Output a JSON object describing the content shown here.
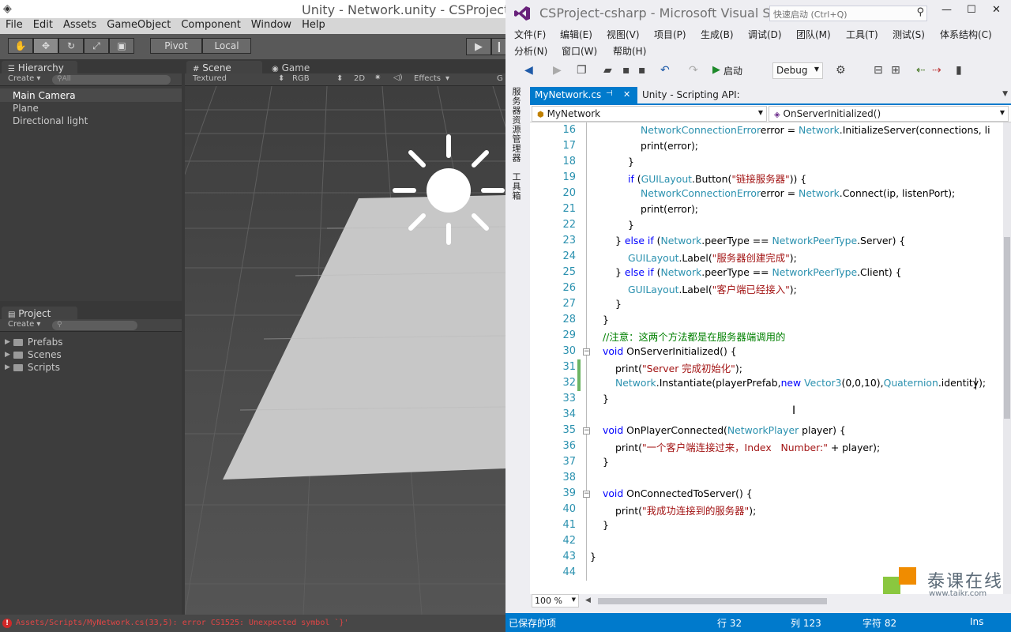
{
  "unity": {
    "title": "Unity - Network.unity - CSProject - P",
    "menu": [
      "File",
      "Edit",
      "Assets",
      "GameObject",
      "Component",
      "Window",
      "Help"
    ],
    "toolbar": {
      "pivot": "Pivot",
      "local": "Local"
    },
    "hierarchy": {
      "tab": "Hierarchy",
      "create": "Create ▾",
      "search": "All",
      "items": [
        "Main Camera",
        "Plane",
        "Directional light"
      ]
    },
    "scene": {
      "tab_scene": "Scene",
      "tab_game": "Game",
      "shading": "Textured",
      "render": "RGB",
      "mode_2d": "2D",
      "effects": "Effects",
      "gizmos": "G"
    },
    "project": {
      "tab": "Project",
      "create": "Create ▾",
      "folders": [
        "Prefabs",
        "Scenes",
        "Scripts"
      ]
    },
    "status_error": "Assets/Scripts/MyNetwork.cs(33,5): error CS1525: Unexpected symbol `}'"
  },
  "vs": {
    "title": "CSProject-csharp - Microsoft Visual St...",
    "quick_launch": "快速启动 (Ctrl+Q)",
    "menu_row1": [
      "文件(F)",
      "编辑(E)",
      "视图(V)",
      "项目(P)",
      "生成(B)",
      "调试(D)",
      "团队(M)",
      "工具(T)",
      "测试(S)",
      "体系结构(C)"
    ],
    "menu_row2": [
      "分析(N)",
      "窗口(W)",
      "帮助(H)"
    ],
    "start": "启动",
    "config": "Debug",
    "side_tabs": [
      "服务器资源管理器",
      "工具箱"
    ],
    "tabs": {
      "active": "MyNetwork.cs",
      "pin": "⊣",
      "close": "✕",
      "other": "Unity - Scripting API:"
    },
    "nav": {
      "class": "MyNetwork",
      "member": "OnServerInitialized()"
    },
    "code": [
      {
        "n": "16",
        "i": 4,
        "parts": [
          [
            "t",
            "NetworkConnectionError"
          ],
          [
            "",
            "error = "
          ],
          [
            "t",
            "Network"
          ],
          [
            "",
            ".InitializeServer(connections, li"
          ]
        ]
      },
      {
        "n": "17",
        "i": 4,
        "parts": [
          [
            "",
            "print(error);"
          ]
        ]
      },
      {
        "n": "18",
        "i": 3,
        "parts": [
          [
            "",
            "}"
          ]
        ]
      },
      {
        "n": "19",
        "i": 3,
        "parts": [
          [
            "k",
            "if"
          ],
          [
            "",
            " ("
          ],
          [
            "t",
            "GUILayout"
          ],
          [
            "",
            ".Button("
          ],
          [
            "s",
            "\"链接服务器\""
          ],
          [
            "",
            ")) {"
          ]
        ]
      },
      {
        "n": "20",
        "i": 4,
        "parts": [
          [
            "t",
            "NetworkConnectionError"
          ],
          [
            "",
            "error = "
          ],
          [
            "t",
            "Network"
          ],
          [
            "",
            ".Connect(ip, listenPort);"
          ]
        ]
      },
      {
        "n": "21",
        "i": 4,
        "parts": [
          [
            "",
            "print(error);"
          ]
        ]
      },
      {
        "n": "22",
        "i": 3,
        "parts": [
          [
            "",
            "}"
          ]
        ]
      },
      {
        "n": "23",
        "i": 2,
        "parts": [
          [
            "",
            "} "
          ],
          [
            "k",
            "else if"
          ],
          [
            "",
            " ("
          ],
          [
            "t",
            "Network"
          ],
          [
            "",
            ".peerType == "
          ],
          [
            "t",
            "NetworkPeerType"
          ],
          [
            "",
            ".Server) {"
          ]
        ]
      },
      {
        "n": "24",
        "i": 3,
        "parts": [
          [
            "t",
            "GUILayout"
          ],
          [
            "",
            ".Label("
          ],
          [
            "s",
            "\"服务器创建完成\""
          ],
          [
            "",
            ");"
          ]
        ]
      },
      {
        "n": "25",
        "i": 2,
        "parts": [
          [
            "",
            "} "
          ],
          [
            "k",
            "else if"
          ],
          [
            "",
            " ("
          ],
          [
            "t",
            "Network"
          ],
          [
            "",
            ".peerType == "
          ],
          [
            "t",
            "NetworkPeerType"
          ],
          [
            "",
            ".Client) {"
          ]
        ]
      },
      {
        "n": "26",
        "i": 3,
        "parts": [
          [
            "t",
            "GUILayout"
          ],
          [
            "",
            ".Label("
          ],
          [
            "s",
            "\"客户端已经接入\""
          ],
          [
            "",
            ");"
          ]
        ]
      },
      {
        "n": "27",
        "i": 2,
        "parts": [
          [
            "",
            "}"
          ]
        ]
      },
      {
        "n": "28",
        "i": 1,
        "parts": [
          [
            "",
            "}"
          ]
        ]
      },
      {
        "n": "29",
        "i": 1,
        "parts": [
          [
            "c",
            "//注意：这两个方法都是在服务器端调用的"
          ]
        ]
      },
      {
        "n": "30",
        "i": 1,
        "parts": [
          [
            "k",
            "void"
          ],
          [
            "",
            " OnServerInitialized() {"
          ]
        ]
      },
      {
        "n": "31",
        "i": 2,
        "parts": [
          [
            "",
            "print("
          ],
          [
            "s",
            "\"Server 完成初始化\""
          ],
          [
            "",
            ");"
          ]
        ]
      },
      {
        "n": "32",
        "i": 2,
        "parts": [
          [
            "t",
            "Network"
          ],
          [
            "",
            ".Instantiate(playerPrefab,"
          ],
          [
            "k",
            "new"
          ],
          [
            "",
            " "
          ],
          [
            "t",
            "Vector3"
          ],
          [
            "",
            "(0,0,10),"
          ],
          [
            "t",
            "Quaternion"
          ],
          [
            "",
            ".identity);"
          ]
        ]
      },
      {
        "n": "33",
        "i": 1,
        "parts": [
          [
            "",
            "}"
          ]
        ]
      },
      {
        "n": "34",
        "i": 0,
        "parts": []
      },
      {
        "n": "35",
        "i": 1,
        "parts": [
          [
            "k",
            "void"
          ],
          [
            "",
            " OnPlayerConnected("
          ],
          [
            "t",
            "NetworkPlayer"
          ],
          [
            "",
            " player) {"
          ]
        ]
      },
      {
        "n": "36",
        "i": 2,
        "parts": [
          [
            "",
            "print("
          ],
          [
            "s",
            "\"一个客户端连接过来，Index   Number:\""
          ],
          [
            "",
            " + player);"
          ]
        ]
      },
      {
        "n": "37",
        "i": 1,
        "parts": [
          [
            "",
            "}"
          ]
        ]
      },
      {
        "n": "38",
        "i": 0,
        "parts": []
      },
      {
        "n": "39",
        "i": 1,
        "parts": [
          [
            "k",
            "void"
          ],
          [
            "",
            " OnConnectedToServer() {"
          ]
        ]
      },
      {
        "n": "40",
        "i": 2,
        "parts": [
          [
            "",
            "print("
          ],
          [
            "s",
            "\"我成功连接到的服务器\""
          ],
          [
            "",
            ");"
          ]
        ]
      },
      {
        "n": "41",
        "i": 1,
        "parts": [
          [
            "",
            "}"
          ]
        ]
      },
      {
        "n": "42",
        "i": 0,
        "parts": []
      },
      {
        "n": "43",
        "i": 0,
        "parts": [
          [
            "",
            "}"
          ]
        ]
      },
      {
        "n": "44",
        "i": 0,
        "parts": []
      }
    ],
    "zoom": "100 %",
    "status": {
      "saved": "已保存的项",
      "line": "行 32",
      "col": "列 123",
      "char": "字符 82",
      "mode": "Ins"
    },
    "watermark": {
      "text": "泰课在线",
      "url": "www.taikr.com"
    }
  },
  "colors": {
    "vs_accent": "#007acc",
    "keyword": "#0000ff",
    "type": "#2b91af",
    "string": "#a31515",
    "comment": "#008000",
    "unity_error": "#d23b3b"
  }
}
